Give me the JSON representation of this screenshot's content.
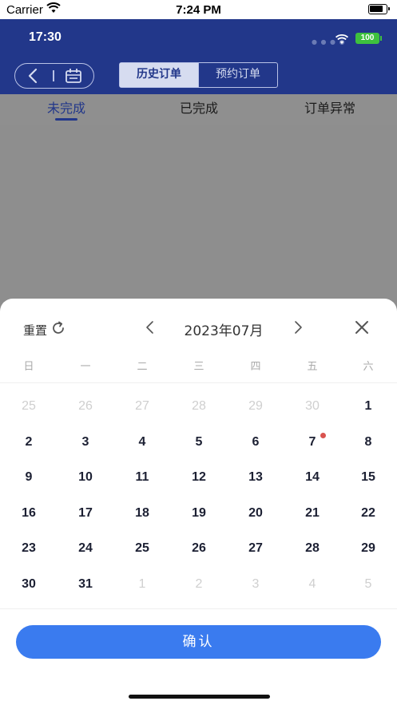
{
  "ios_status": {
    "carrier": "Carrier",
    "time": "7:24 PM"
  },
  "app_status": {
    "time": "17:30",
    "battery": "100"
  },
  "header": {
    "segment": {
      "active": "历史订单",
      "inactive": "预约订单"
    }
  },
  "tabs": [
    "未完成",
    "已完成",
    "订单异常"
  ],
  "sheet": {
    "reset_label": "重置",
    "month_title": "2023年07月",
    "weekdays": [
      "日",
      "一",
      "二",
      "三",
      "四",
      "五",
      "六"
    ],
    "weeks": [
      [
        {
          "d": "25",
          "m": true
        },
        {
          "d": "26",
          "m": true
        },
        {
          "d": "27",
          "m": true
        },
        {
          "d": "28",
          "m": true
        },
        {
          "d": "29",
          "m": true
        },
        {
          "d": "30",
          "m": true
        },
        {
          "d": "1",
          "m": false
        }
      ],
      [
        {
          "d": "2",
          "m": false
        },
        {
          "d": "3",
          "m": false
        },
        {
          "d": "4",
          "m": false
        },
        {
          "d": "5",
          "m": false
        },
        {
          "d": "6",
          "m": false
        },
        {
          "d": "7",
          "m": false,
          "dot": true
        },
        {
          "d": "8",
          "m": false
        }
      ],
      [
        {
          "d": "9",
          "m": false
        },
        {
          "d": "10",
          "m": false
        },
        {
          "d": "11",
          "m": false
        },
        {
          "d": "12",
          "m": false
        },
        {
          "d": "13",
          "m": false
        },
        {
          "d": "14",
          "m": false
        },
        {
          "d": "15",
          "m": false
        }
      ],
      [
        {
          "d": "16",
          "m": false
        },
        {
          "d": "17",
          "m": false
        },
        {
          "d": "18",
          "m": false
        },
        {
          "d": "19",
          "m": false
        },
        {
          "d": "20",
          "m": false
        },
        {
          "d": "21",
          "m": false
        },
        {
          "d": "22",
          "m": false
        }
      ],
      [
        {
          "d": "23",
          "m": false
        },
        {
          "d": "24",
          "m": false
        },
        {
          "d": "25",
          "m": false
        },
        {
          "d": "26",
          "m": false
        },
        {
          "d": "27",
          "m": false
        },
        {
          "d": "28",
          "m": false
        },
        {
          "d": "29",
          "m": false
        }
      ],
      [
        {
          "d": "30",
          "m": false
        },
        {
          "d": "31",
          "m": false
        },
        {
          "d": "1",
          "m": true
        },
        {
          "d": "2",
          "m": true
        },
        {
          "d": "3",
          "m": true
        },
        {
          "d": "4",
          "m": true
        },
        {
          "d": "5",
          "m": true
        }
      ]
    ],
    "confirm_label": "确认"
  },
  "colors": {
    "brand": "#22378a",
    "primary": "#3a7bef",
    "event_dot": "#d9534f"
  }
}
